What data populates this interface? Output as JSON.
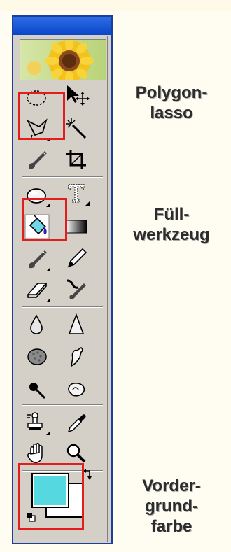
{
  "callouts": {
    "polygon_lasso": [
      "Polygon-",
      "lasso"
    ],
    "fill_tool": [
      "Füll-",
      "werkzeug"
    ],
    "foreground_color": [
      "Vorder-",
      "grund-",
      "farbe"
    ]
  },
  "colors": {
    "titlebar": "#1b58d8",
    "toolbox_bg": "#d4d0c8",
    "highlight": "#e51c1c",
    "foreground_swatch": "#55d8e0",
    "background_swatch": "#ffffff"
  },
  "tools": [
    "marquee-ellipse-icon",
    "move-icon",
    "polygon-lasso-icon",
    "magic-wand-icon",
    "brush-icon",
    "crop-icon",
    "ellipse-shape-icon",
    "text-icon",
    "paint-bucket-icon",
    "gradient-icon",
    "brush-icon",
    "pencil-icon",
    "eraser-icon",
    "history-brush-icon",
    "blur-icon",
    "sharpen-icon",
    "sponge-icon",
    "smudge-icon",
    "burn-icon",
    "dodge-icon",
    "stamp-icon",
    "eyedropper-icon",
    "hand-icon",
    "zoom-icon"
  ]
}
